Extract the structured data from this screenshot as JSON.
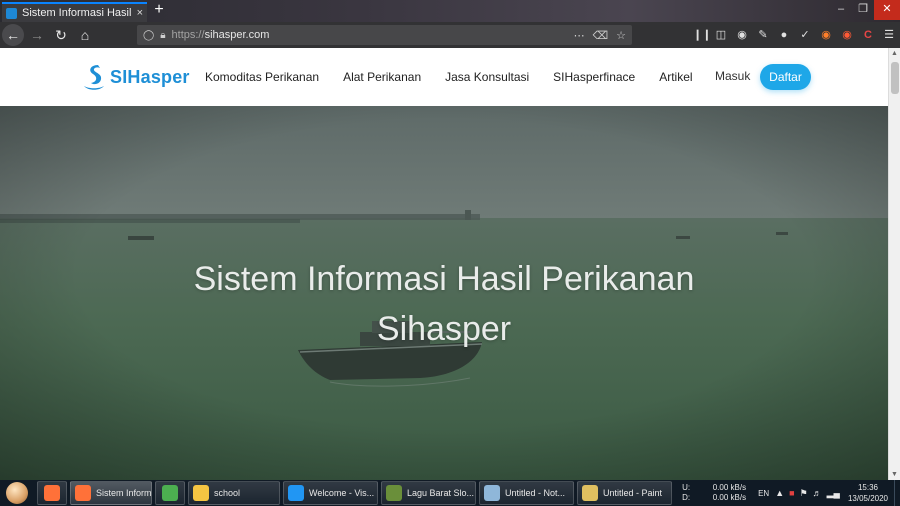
{
  "browser": {
    "tab_title": "Sistem Informasi Hasil Perikanan",
    "tab_close": "×",
    "new_tab": "+",
    "url_proto": "https://",
    "url_host": "sihasper.com",
    "window_controls": [
      "–",
      "❐",
      "✕"
    ]
  },
  "site": {
    "logo_text": "SIHasper",
    "menu": [
      "Komoditas Perikanan",
      "Alat Perikanan",
      "Jasa Konsultasi",
      "SIHasperfinace",
      "Artikel"
    ],
    "login": "Masuk",
    "register": "Daftar",
    "hero_line1": "Sistem Informasi Hasil Perikanan",
    "hero_line2": "Sihasper"
  },
  "taskbar": {
    "items": [
      {
        "label": "",
        "icon": "firefox-icon",
        "color": "#ff7139"
      },
      {
        "label": "Sistem Inform...",
        "icon": "firefox-icon",
        "color": "#ff7139",
        "active": true
      },
      {
        "label": "",
        "icon": "chrome-icon",
        "color": "#4caf50"
      },
      {
        "label": "school",
        "icon": "folder-icon",
        "color": "#f5c542"
      },
      {
        "label": "Welcome - Vis...",
        "icon": "vscode-icon",
        "color": "#2196f3"
      },
      {
        "label": "Lagu Barat Slo...",
        "icon": "media-player-icon",
        "color": "#6a8f3a"
      },
      {
        "label": "Untitled - Not...",
        "icon": "notepad-icon",
        "color": "#8fb7d9"
      },
      {
        "label": "Untitled - Paint",
        "icon": "paint-icon",
        "color": "#e0c060"
      }
    ],
    "net_up_label": "U:",
    "net_up": "0.00 kB/s",
    "net_down_label": "D:",
    "net_down": "0.00 kB/s",
    "lang": "EN",
    "time": "15:36",
    "date": "13/05/2020"
  }
}
